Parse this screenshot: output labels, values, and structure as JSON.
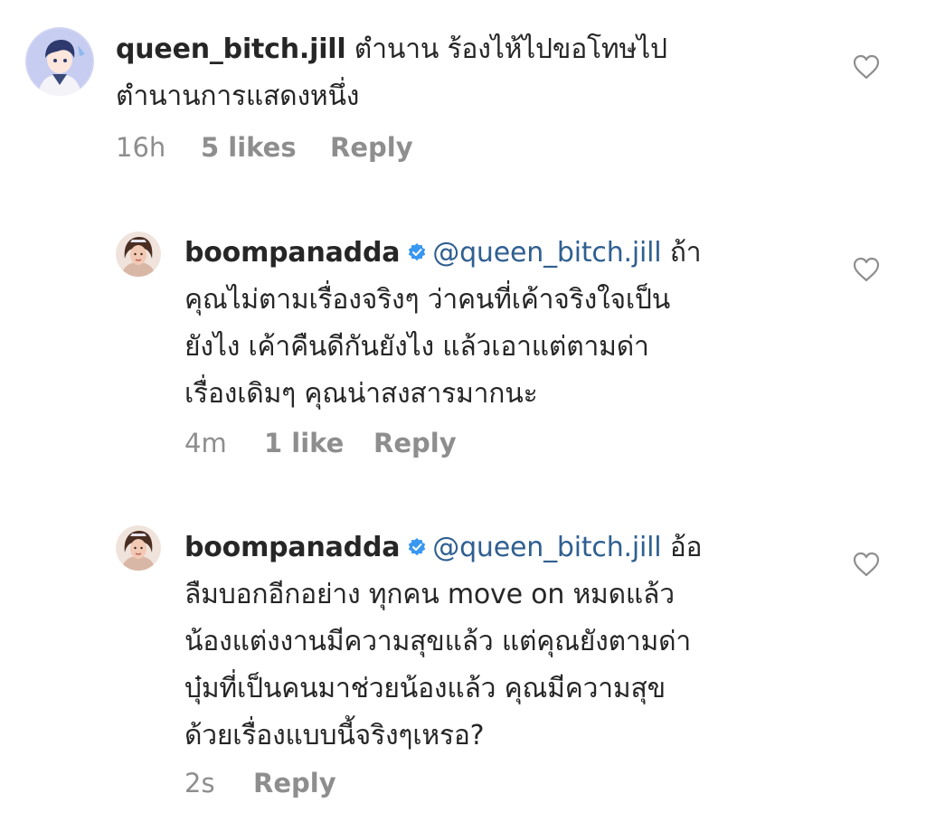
{
  "comments": [
    {
      "username": "queen_bitch.jill",
      "verified": false,
      "mention": "",
      "line1": "ตำนาน ร้องไห้ไปขอโทษไป",
      "lines": [
        "ตำนานการแสดงหนึ่ง"
      ],
      "time": "16h",
      "likes": "5 likes",
      "reply": "Reply",
      "avatar_icon": "anime-avatar",
      "like_icon": "heart-outline-icon"
    },
    {
      "username": "boompanadda",
      "verified": true,
      "mention": "@queen_bitch.jill",
      "line1": "ถ้า",
      "lines": [
        "คุณไม่ตามเรื่องจริงๆ ว่าคนที่เค้าจริงใจเป็น",
        "ยังไง เค้าคืนดีกันยังไง แล้วเอาแต่ตามด่า",
        "เรื่องเดิมๆ คุณน่าสงสารมากนะ"
      ],
      "time": "4m",
      "likes": "1 like",
      "reply": "Reply",
      "avatar_icon": "profile-photo-avatar",
      "like_icon": "heart-outline-icon"
    },
    {
      "username": "boompanadda",
      "verified": true,
      "mention": "@queen_bitch.jill",
      "line1": "อ้อ",
      "lines": [
        "ลืมบอกอีกอย่าง ทุกคน move on หมดแล้ว",
        "น้องแต่งงานมีความสุขแล้ว แต่คุณยังตามด่า",
        "บุ๋มที่เป็นคนมาช่วยน้องแล้ว คุณมีความสุข",
        "ด้วยเรื่องแบบนี้จริงๆเหรอ?"
      ],
      "time": "2s",
      "likes": "",
      "reply": "Reply",
      "avatar_icon": "profile-photo-avatar",
      "like_icon": "heart-outline-icon"
    }
  ],
  "colors": {
    "text": "#262626",
    "mention": "#2f5f91",
    "meta": "#8e8e8e",
    "verified": "#3897f0"
  }
}
